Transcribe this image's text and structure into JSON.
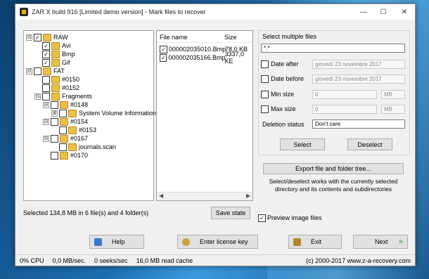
{
  "window": {
    "title": "ZAR X build 916 [Limited demo version] - Mark files to recover",
    "controls": {
      "minimize": "—",
      "maximize": "☐",
      "close": "✕"
    }
  },
  "tree": {
    "items": [
      {
        "label": "RAW",
        "exp": "⊟",
        "checked": "✓",
        "indent": 0
      },
      {
        "label": "Avi",
        "exp": "",
        "checked": "✓",
        "indent": 1
      },
      {
        "label": "Bmp",
        "exp": "",
        "checked": "✓",
        "indent": 1
      },
      {
        "label": "Gif",
        "exp": "",
        "checked": "✓",
        "indent": 1
      },
      {
        "label": "FAT",
        "exp": "⊟",
        "checked": "",
        "indent": 0
      },
      {
        "label": "#0150",
        "exp": "",
        "checked": "",
        "indent": 1
      },
      {
        "label": "#0152",
        "exp": "",
        "checked": "",
        "indent": 1
      },
      {
        "label": "Fragments",
        "exp": "⊟",
        "checked": "",
        "indent": 1
      },
      {
        "label": "#0148",
        "exp": "⊟",
        "checked": "",
        "indent": 2
      },
      {
        "label": "System Volume Information",
        "exp": "⊞",
        "checked": "",
        "indent": 3
      },
      {
        "label": "#0154",
        "exp": "⊟",
        "checked": "",
        "indent": 2
      },
      {
        "label": "#0153",
        "exp": "",
        "checked": "",
        "indent": 3
      },
      {
        "label": "#0167",
        "exp": "⊟",
        "checked": "",
        "indent": 2
      },
      {
        "label": "journals.scan",
        "exp": "",
        "checked": "",
        "indent": 3
      },
      {
        "label": "#0170",
        "exp": "",
        "checked": "",
        "indent": 2
      }
    ]
  },
  "files": {
    "col_name": "File name",
    "col_size": "Size",
    "rows": [
      {
        "name": "000002035010.Bmp",
        "size": "78,0 KB",
        "checked": "✓"
      },
      {
        "name": "000002035166.Bmp",
        "size": "3337,0 KE",
        "checked": "✓"
      }
    ]
  },
  "selected_text": "Selected 134,8 MB in 6 file(s) and 4 folder(s)",
  "save_state": "Save state",
  "select_multiple": {
    "title": "Select multiple files",
    "mask": "*.*",
    "date_after": "Date after",
    "date_after_value": "giovedì  23 novembre 2017",
    "date_before": "Date before",
    "date_before_value": "giovedì  23 novembre 2017",
    "min_size": "Min size",
    "min_size_value": "0",
    "min_size_unit": "MB",
    "max_size": "Max size",
    "max_size_value": "0",
    "max_size_unit": "MB",
    "deletion_status": "Deletion status",
    "deletion_value": "Don't care",
    "select": "Select",
    "deselect": "Deselect"
  },
  "export_btn": "Export file and folder tree...",
  "info_text": "Select/deselect works with the currently selected directory and its contents and subdirectories",
  "preview": {
    "label": "Preview image files",
    "checked": "✓"
  },
  "buttons": {
    "help": "Help",
    "license": "Enter license key",
    "exit": "Exit",
    "next": "Next"
  },
  "status": {
    "cpu": "0% CPU",
    "mbsec": "0,0 MB/sec.",
    "seeks": "0 seeks/sec",
    "cache": "16,0 MB read cache",
    "copyright": "(c) 2000-2017 www.z-a-recovery.com"
  }
}
